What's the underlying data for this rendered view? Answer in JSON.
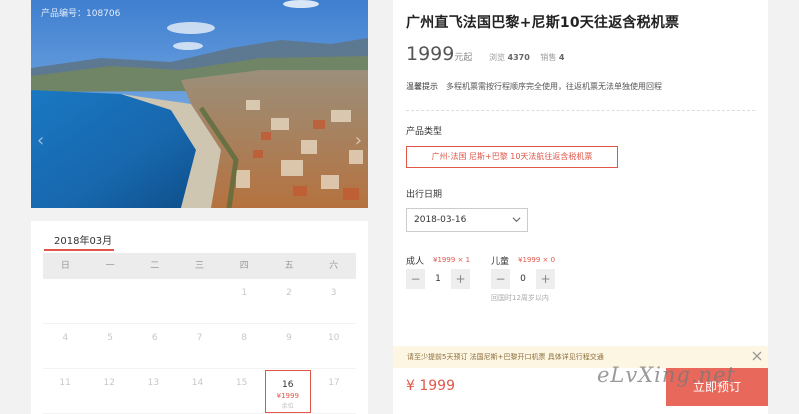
{
  "photo": {
    "product_id_label": "产品编号：108706",
    "prev_arrow": "‹",
    "next_arrow": "›"
  },
  "calendar": {
    "month_label": "2018年03月",
    "weekdays": [
      "日",
      "一",
      "二",
      "三",
      "四",
      "五",
      "六"
    ],
    "rows": [
      [
        "",
        "",
        "",
        "",
        "1",
        "2",
        "3"
      ],
      [
        "4",
        "5",
        "6",
        "7",
        "8",
        "9",
        "10"
      ],
      [
        "11",
        "12",
        "13",
        "14",
        "15",
        "16",
        "17"
      ]
    ],
    "active_day": {
      "day": "16",
      "price": "¥1999",
      "stock": "余位"
    }
  },
  "product": {
    "title": "广州直飞法国巴黎+尼斯10天往返含税机票",
    "price_value": "1999",
    "price_unit": "元起",
    "views_label": "浏览",
    "views_value": "4370",
    "sales_label": "销售",
    "sales_value": "4",
    "notice_label": "温馨提示",
    "notice_text": "多程机票需按行程顺序完全使用，往返机票无法单独使用回程"
  },
  "options": {
    "type_label": "产品类型",
    "type_value": "广州-法国 尼斯+巴黎 10天法航往返含税机票",
    "date_label": "出行日期",
    "date_value": "2018-03-16"
  },
  "quantity": {
    "adult_label": "成人",
    "adult_price": "¥1999 × 1",
    "adult_count": "1",
    "child_label": "儿童",
    "child_price": "¥1999 × 0",
    "child_count": "0",
    "child_note": "回国时12周岁以内",
    "minus": "−",
    "plus": "+"
  },
  "tip_bar": {
    "text": "请至少提前5天预订 法国尼斯+巴黎开口机票 具体详见行程交通"
  },
  "footer": {
    "total_price": "¥ 1999",
    "book_label": "立即预订"
  },
  "watermark": "eLvXing.net",
  "colors": {
    "accent": "#e0574a",
    "button_bg": "#e8685c",
    "tip_bg": "#fdf6e3"
  }
}
